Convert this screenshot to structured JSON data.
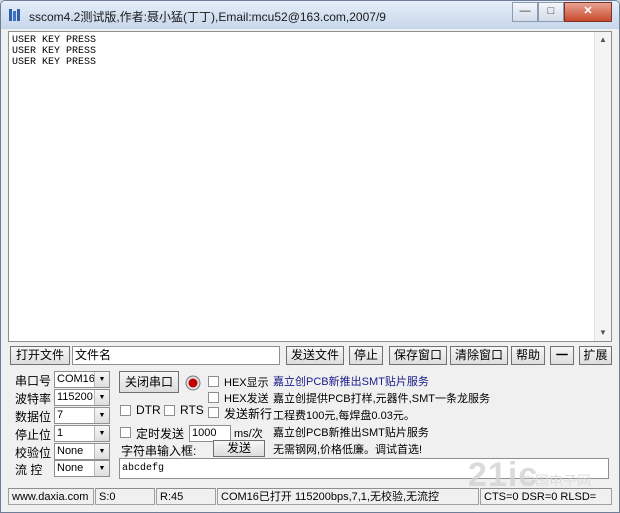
{
  "window": {
    "title": "sscom4.2测试版,作者:聂小猛(丁丁),Email:mcu52@163.com,2007/9",
    "min": "—",
    "max": "□",
    "close": "✕"
  },
  "receive": {
    "text": "USER KEY PRESS\nUSER KEY PRESS\nUSER KEY PRESS"
  },
  "file_bar": {
    "open_file": "打开文件",
    "file_name_placeholder": "文件名",
    "send_file": "发送文件",
    "stop": "停止",
    "save_window": "保存窗口",
    "clear_window": "清除窗口",
    "help": "帮助",
    "minus": "一",
    "expand": "扩展"
  },
  "settings": {
    "port_label": "串口号",
    "port_value": "COM16",
    "baud_label": "波特率",
    "baud_value": "115200",
    "databits_label": "数据位",
    "databits_value": "7",
    "stopbits_label": "停止位",
    "stopbits_value": "1",
    "parity_label": "校验位",
    "parity_value": "None",
    "flow_label": "流 控",
    "flow_value": "None",
    "close_port": "关闭串口",
    "hex_display": "HEX显示",
    "hex_send": "HEX发送",
    "send_newline": "发送新行",
    "dtr": "DTR",
    "rts": "RTS",
    "timed_send": "定时发送",
    "interval_value": "1000",
    "interval_unit": "ms/次",
    "string_input_label": "字符串输入框:",
    "send": "发送",
    "send_text": "abcdefg"
  },
  "ads": [
    "嘉立创PCB新推出SMT贴片服务",
    "嘉立创提供PCB打样,元器件,SMT一条龙服务",
    "工程费100元,每焊盘0.03元。",
    "嘉立创PCB新推出SMT贴片服务",
    "无需钢网,价格低廉。调试首选!"
  ],
  "status": {
    "website": "www.daxia.com",
    "sent": "S:0",
    "received": "R:45",
    "port_info": "COM16已打开  115200bps,7,1,无校验,无流控",
    "lines": "CTS=0 DSR=0 RLSD="
  },
  "watermark": {
    "main": "21ic",
    "sub": "中国电子网"
  },
  "colors": {
    "ad_text": "#1a1a8c",
    "record_red": "#c00000"
  }
}
